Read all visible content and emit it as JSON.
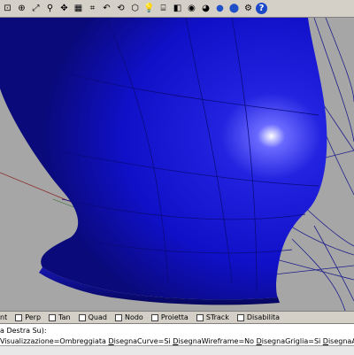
{
  "toolbar": {
    "icons": [
      {
        "name": "zoom-window-icon",
        "glyph": "⊡"
      },
      {
        "name": "zoom-dynamic-icon",
        "glyph": "⊕"
      },
      {
        "name": "zoom-extents-icon",
        "glyph": "⤢"
      },
      {
        "name": "zoom-selected-icon",
        "glyph": "⚲"
      },
      {
        "name": "pan-icon",
        "glyph": "✥"
      },
      {
        "name": "four-view-icon",
        "glyph": "▦"
      },
      {
        "name": "grid-icon",
        "glyph": "⌗"
      },
      {
        "name": "undo-view-icon",
        "glyph": "↶"
      },
      {
        "name": "rotate-view-icon",
        "glyph": "⟲"
      },
      {
        "name": "construction-plane-icon",
        "glyph": "⬡"
      },
      {
        "name": "lightbulb-icon",
        "glyph": "💡"
      },
      {
        "name": "properties-icon",
        "glyph": "⌸"
      },
      {
        "name": "layer-icon",
        "glyph": "◧"
      },
      {
        "name": "color-wheel-icon",
        "glyph": "◉"
      },
      {
        "name": "rendered-icon",
        "glyph": "◕"
      },
      {
        "name": "shaded-sphere-icon",
        "glyph": "●"
      },
      {
        "name": "render-icon",
        "glyph": "⬤"
      },
      {
        "name": "settings-icon",
        "glyph": "⚙"
      },
      {
        "name": "help-icon",
        "glyph": "?"
      }
    ],
    "colors": {
      "help": "#1b47c9",
      "sphere": "#2050c8"
    }
  },
  "osnap": {
    "items": [
      {
        "label": "nt",
        "checked": false
      },
      {
        "label": "Perp",
        "checked": false
      },
      {
        "label": "Tan",
        "checked": false
      },
      {
        "label": "Quad",
        "checked": false
      },
      {
        "label": "Nodo",
        "checked": false
      },
      {
        "label": "Proietta",
        "checked": false
      },
      {
        "label": "STrack",
        "checked": false
      },
      {
        "label": "Disabilita",
        "checked": false
      }
    ]
  },
  "command": {
    "history": "a  Destra  Su):",
    "prompt_parts": [
      {
        "text": "Visualizzazione=",
        "u": false
      },
      {
        "text": "Ombreggiata",
        "u": false
      },
      {
        "text": " ",
        "u": false
      },
      {
        "text": "D",
        "u": true
      },
      {
        "text": "isegnaCurve=Si ",
        "u": false
      },
      {
        "text": "D",
        "u": true
      },
      {
        "text": "isegnaWireframe=No ",
        "u": false
      },
      {
        "text": "D",
        "u": true
      },
      {
        "text": "isegnaGriglia=Si ",
        "u": false
      },
      {
        "text": "D",
        "u": true
      },
      {
        "text": "isegnaAssi=Si ):",
        "u": false
      }
    ]
  },
  "viewport": {
    "background": "#a6a6a6",
    "surface_color": "#1010c8",
    "surface_dark": "#0a0a7a",
    "wire_color": "#1e1e8c",
    "axis_red": "#8b2a2a",
    "axis_green": "#2f6b2f"
  }
}
